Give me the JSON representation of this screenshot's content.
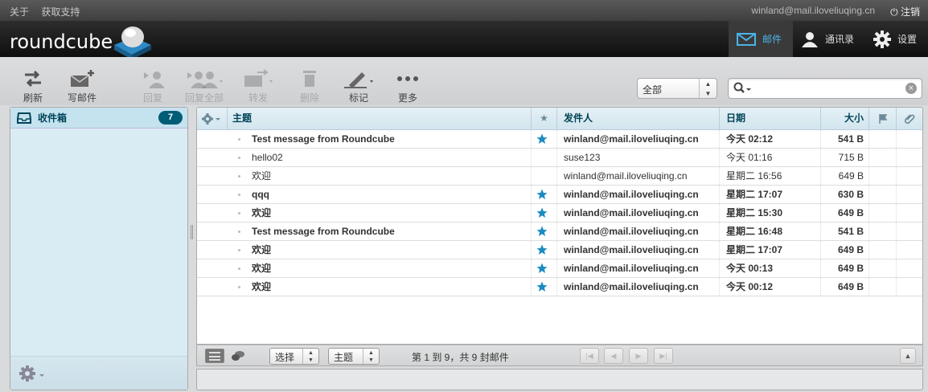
{
  "topline": {
    "links": [
      "关于",
      "获取支持"
    ],
    "user": "winland@mail.iloveliuqing.cn",
    "logout": "注销"
  },
  "header": {
    "logo_text": "roundcube",
    "tasks": [
      {
        "label": "邮件",
        "icon": "mail-icon",
        "active": true
      },
      {
        "label": "通讯录",
        "icon": "contacts-icon",
        "active": false
      },
      {
        "label": "设置",
        "icon": "gear-icon",
        "active": false
      }
    ]
  },
  "toolbar": {
    "refresh": "刷新",
    "compose": "写邮件",
    "reply": "回复",
    "reply_all": "回复全部",
    "forward": "转发",
    "delete": "删除",
    "mark": "标记",
    "more": "更多"
  },
  "filter": {
    "value": "全部"
  },
  "search": {
    "placeholder": ""
  },
  "folders": {
    "items": [
      {
        "name": "收件箱",
        "unread": "7"
      }
    ]
  },
  "list": {
    "columns": {
      "subject": "主题",
      "from": "发件人",
      "date": "日期",
      "size": "大小"
    },
    "rows": [
      {
        "subject": "Test message from Roundcube",
        "from": "winland@mail.iloveliuqing.cn",
        "date": "今天 02:12",
        "size": "541 B",
        "unread": true,
        "flagged": true
      },
      {
        "subject": "hello02",
        "from": "suse123",
        "date": "今天 01:16",
        "size": "715 B",
        "unread": false,
        "flagged": false
      },
      {
        "subject": "欢迎",
        "from": "winland@mail.iloveliuqing.cn",
        "date": "星期二 16:56",
        "size": "649 B",
        "unread": false,
        "flagged": false
      },
      {
        "subject": "qqq",
        "from": "winland@mail.iloveliuqing.cn",
        "date": "星期二 17:07",
        "size": "630 B",
        "unread": true,
        "flagged": true
      },
      {
        "subject": "欢迎",
        "from": "winland@mail.iloveliuqing.cn",
        "date": "星期二 15:30",
        "size": "649 B",
        "unread": true,
        "flagged": true
      },
      {
        "subject": "Test message from Roundcube",
        "from": "winland@mail.iloveliuqing.cn",
        "date": "星期二 16:48",
        "size": "541 B",
        "unread": true,
        "flagged": true
      },
      {
        "subject": "欢迎",
        "from": "winland@mail.iloveliuqing.cn",
        "date": "星期二 17:07",
        "size": "649 B",
        "unread": true,
        "flagged": true
      },
      {
        "subject": "欢迎",
        "from": "winland@mail.iloveliuqing.cn",
        "date": "今天 00:13",
        "size": "649 B",
        "unread": true,
        "flagged": true
      },
      {
        "subject": "欢迎",
        "from": "winland@mail.iloveliuqing.cn",
        "date": "今天 00:12",
        "size": "649 B",
        "unread": true,
        "flagged": true
      }
    ]
  },
  "list_footer": {
    "select": "选择",
    "threads": "主题",
    "count": "第 1 到 9，共 9 封邮件"
  },
  "colors": {
    "accent": "#4ab4e8",
    "star": "#1a8cc0",
    "badge": "#005d76"
  }
}
